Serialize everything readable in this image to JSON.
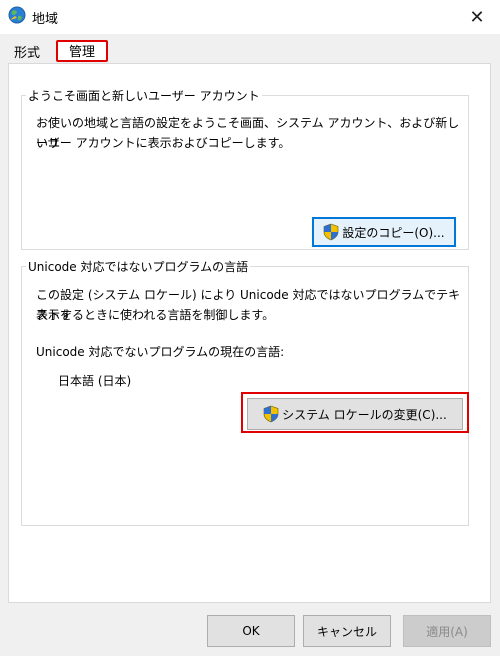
{
  "window": {
    "title": "地域",
    "close_symbol": "✕"
  },
  "tabs": [
    {
      "label": "形式"
    },
    {
      "label": "管理"
    }
  ],
  "welcome_group": {
    "legend": "ようこそ画面と新しいユーザー アカウント",
    "line1": "お使いの地域と言語の設定をようこそ画面、システム アカウント、および新しいユ",
    "line2": "ーザー アカウントに表示およびコピーします。",
    "copy_button_label": "設定のコピー(O)..."
  },
  "nonunicode_group": {
    "legend": "Unicode 対応ではないプログラムの言語",
    "line1": "この設定 (システム ロケール) により Unicode 対応ではないプログラムでテキストを",
    "line2": "表示するときに使われる言語を制御します。",
    "current_label": "Unicode 対応でないプログラムの現在の言語:",
    "current_value": "日本語 (日本)",
    "change_button_label": "システム ロケールの変更(C)..."
  },
  "footer": {
    "ok_label": "OK",
    "cancel_label": "キャンセル",
    "apply_label": "適用(A)"
  },
  "colors": {
    "highlight_red": "#e00000",
    "default_button_border": "#0078d7"
  },
  "icons": {
    "window_icon": "globe-icon",
    "button_icon": "uac-shield-icon"
  }
}
